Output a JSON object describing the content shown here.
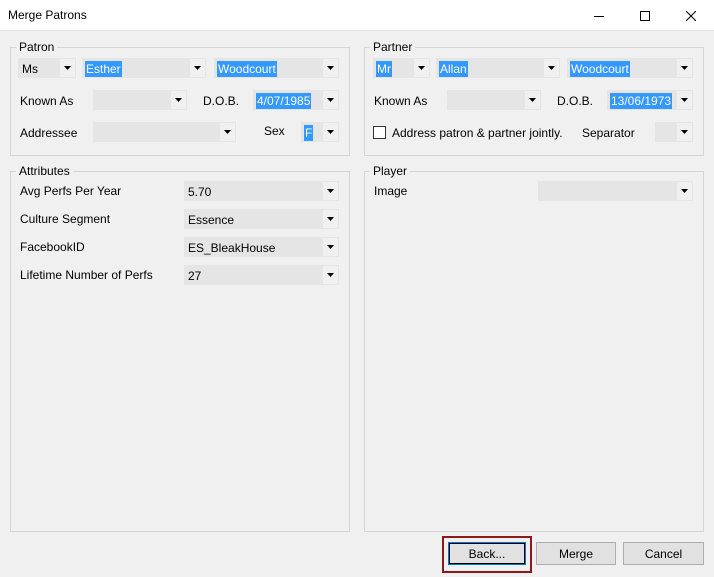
{
  "window": {
    "title": "Merge Patrons"
  },
  "patron": {
    "legend": "Patron",
    "title_value": "Ms",
    "first_name": "Esther",
    "last_name": "Woodcourt",
    "known_as_label": "Known As",
    "known_as_value": "",
    "dob_label": "D.O.B.",
    "dob_value": "4/07/1985",
    "addressee_label": "Addressee",
    "addressee_value": "",
    "sex_label": "Sex",
    "sex_value": "F"
  },
  "partner": {
    "legend": "Partner",
    "title_value": "Mr",
    "first_name": "Allan",
    "last_name": "Woodcourt",
    "known_as_label": "Known As",
    "known_as_value": "",
    "dob_label": "D.O.B.",
    "dob_value": "13/06/1973",
    "joint_label": "Address patron & partner jointly.",
    "separator_label": "Separator",
    "separator_value": ""
  },
  "attributes": {
    "legend": "Attributes",
    "rows": [
      {
        "label": "Avg Perfs Per Year",
        "value": "5.70"
      },
      {
        "label": "Culture Segment",
        "value": "Essence"
      },
      {
        "label": "FacebookID",
        "value": "ES_BleakHouse"
      },
      {
        "label": "Lifetime Number of Perfs",
        "value": "27"
      }
    ]
  },
  "player": {
    "legend": "Player",
    "image_label": "Image",
    "image_value": ""
  },
  "buttons": {
    "back": "Back...",
    "merge": "Merge",
    "cancel": "Cancel"
  },
  "colors": {
    "selection": "#3399ff",
    "focus_ring": "#8b1a1a",
    "combo_bg": "#e5e5e5"
  }
}
